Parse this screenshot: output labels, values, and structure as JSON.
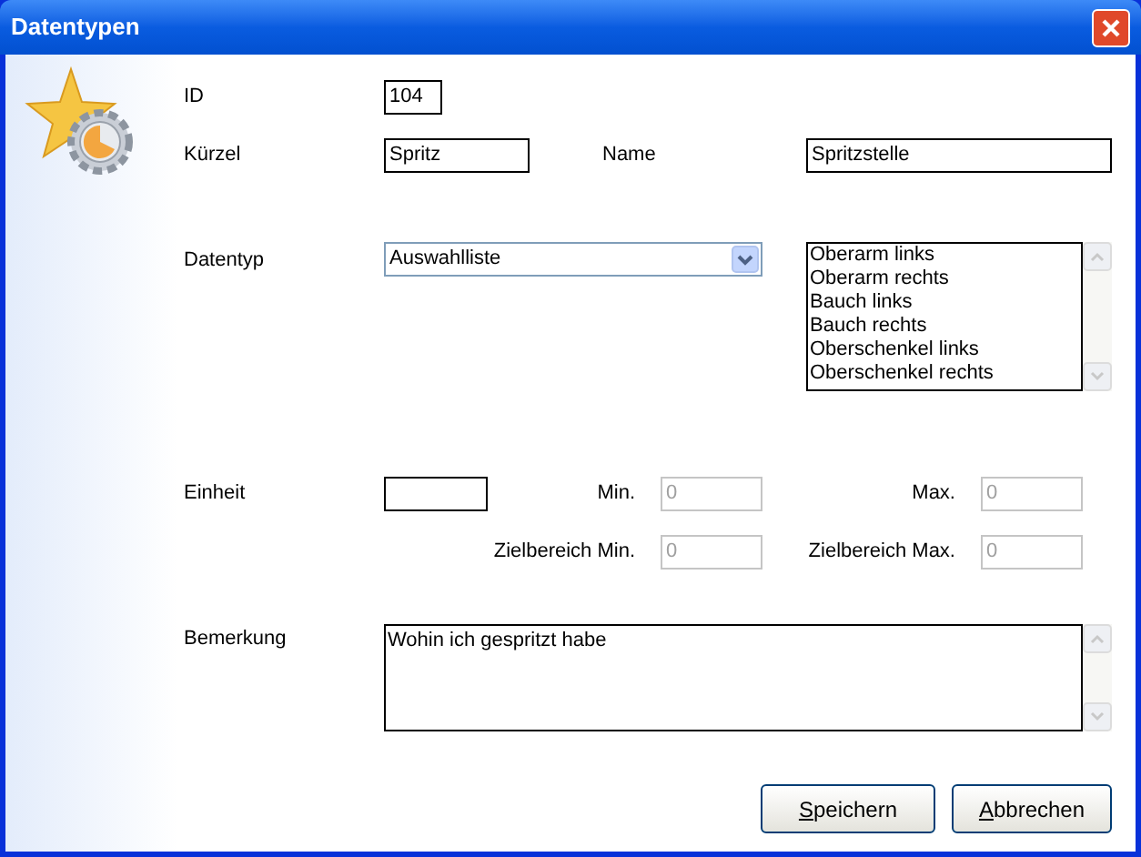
{
  "window": {
    "title": "Datentypen"
  },
  "id": {
    "label": "ID",
    "value": "104"
  },
  "kuerzel": {
    "label": "Kürzel",
    "value": "Spritz"
  },
  "name": {
    "label": "Name",
    "value": "Spritzstelle"
  },
  "datentyp": {
    "label": "Datentyp",
    "value": "Auswahlliste",
    "list_items": [
      "Oberarm links",
      "Oberarm rechts",
      "Bauch links",
      "Bauch rechts",
      "Oberschenkel links",
      "Oberschenkel rechts"
    ]
  },
  "einheit": {
    "label": "Einheit"
  },
  "range_fields": [
    {
      "label": "Min.",
      "value": "0",
      "disabled": true
    },
    {
      "label": "Max.",
      "value": "0",
      "disabled": true
    },
    {
      "label": "Zielbereich Min.",
      "value": "0",
      "disabled": true
    },
    {
      "label": "Zielbereich Max.",
      "value": "0",
      "disabled": true
    }
  ],
  "bemerkung": {
    "label": "Bemerkung",
    "value": "Wohin ich gespritzt habe"
  },
  "buttons": [
    {
      "label": "Speichern",
      "first_letter_underlined": true
    },
    {
      "label": "Abbrechen",
      "first_letter_underlined": true
    }
  ]
}
